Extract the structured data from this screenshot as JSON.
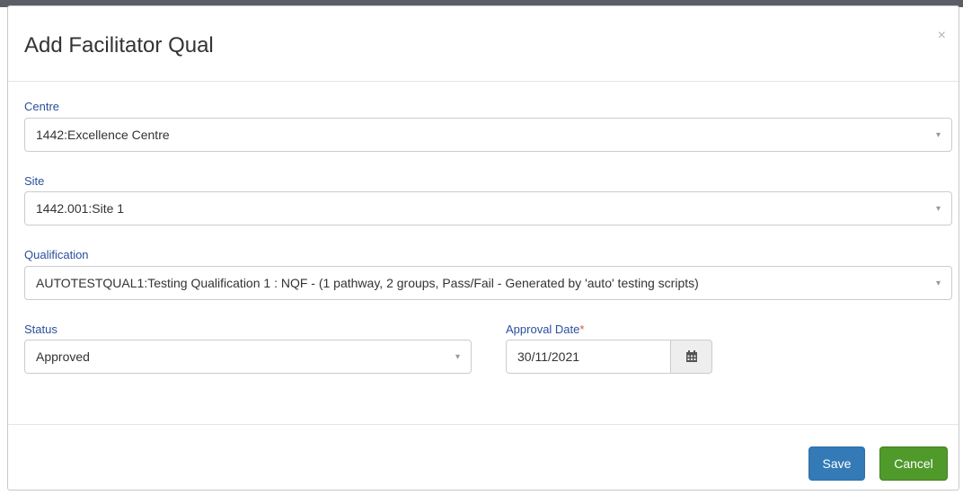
{
  "modal": {
    "title": "Add Facilitator Qual",
    "close_glyph": "×"
  },
  "fields": {
    "centre": {
      "label": "Centre",
      "value": "1442:Excellence Centre"
    },
    "site": {
      "label": "Site",
      "value": "1442.001:Site 1"
    },
    "qualification": {
      "label": "Qualification",
      "value": "AUTOTESTQUAL1:Testing Qualification 1 : NQF - (1 pathway, 2 groups, Pass/Fail - Generated by 'auto' testing scripts)"
    },
    "status": {
      "label": "Status",
      "value": "Approved"
    },
    "approval_date": {
      "label": "Approval Date",
      "required_mark": "*",
      "value": "30/11/2021"
    }
  },
  "dropdown_arrow": "▾",
  "footer": {
    "save_label": "Save",
    "cancel_label": "Cancel"
  },
  "colors": {
    "label": "#2b4f9c",
    "required": "#d9534f",
    "save_button": "#337ab7",
    "cancel_button": "#4f9a2b"
  },
  "icons": {
    "close": "close-icon",
    "dropdown": "chevron-down-icon",
    "calendar": "calendar-icon"
  }
}
